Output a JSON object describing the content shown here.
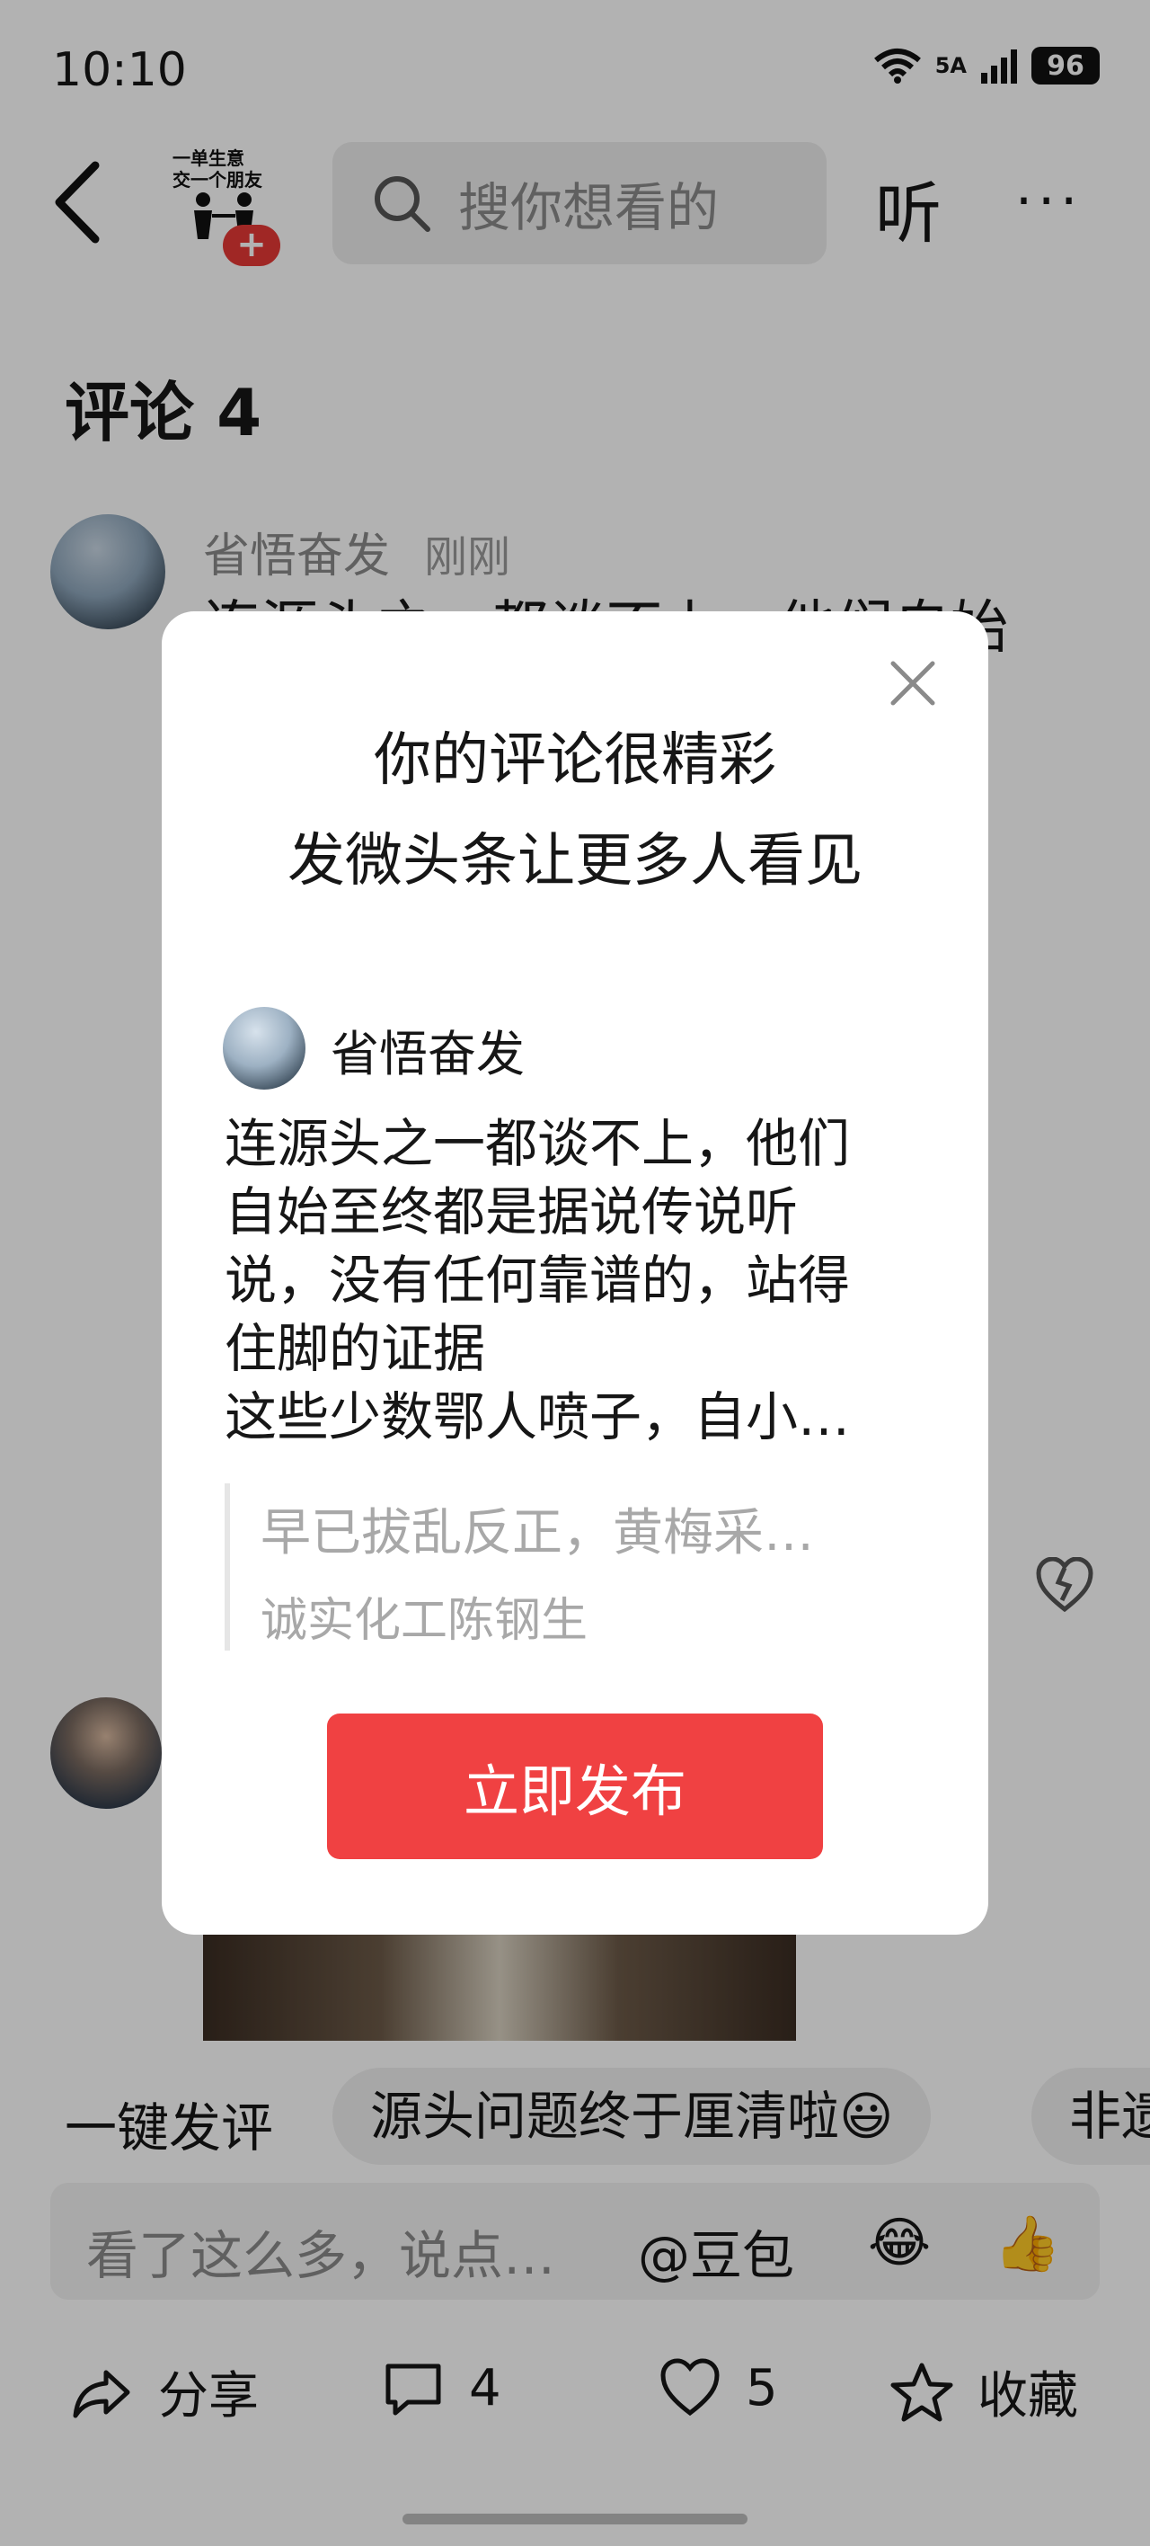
{
  "status_bar": {
    "time": "10:10",
    "network": "5A",
    "battery": "96"
  },
  "header": {
    "logo_text": [
      "一单生意",
      "交一个朋友"
    ],
    "logo_plus": "+",
    "search_placeholder": "搜你想看的",
    "listen_label": "听",
    "more_label": "···"
  },
  "comments": {
    "title": "评论 4",
    "items": [
      {
        "author": "省悟奋发",
        "time": "刚刚",
        "text_partial": "连源头之一都谈不上，他们自始\n                                有任\n\n                                故牛\n                                村、\n                                洋口\n                                练了\n                                街，"
      }
    ]
  },
  "chips": {
    "label": "一键发评",
    "items": [
      "源头问题终于厘清啦😃",
      "非遗"
    ]
  },
  "input": {
    "placeholder": "看了这么多，说点…",
    "mention": "@豆包",
    "emoji1": "😂",
    "emoji2": "👍"
  },
  "bottom_bar": {
    "share": "分享",
    "comments_count": "4",
    "likes_count": "5",
    "favorite": "收藏"
  },
  "modal": {
    "title_line1": "你的评论很精彩",
    "title_line2": "发微头条让更多人看见",
    "author": "省悟奋发",
    "comment_text": "连源头之一都谈不上，他们\n自始至终都是据说传说听\n说，没有任何靠谱的，站得\n住脚的证据\n这些少数鄂人喷子，自小…",
    "quote_text": "早已拔乱反正，黄梅采…",
    "quote_author": "诚实化工陈钢生",
    "publish_label": "立即发布"
  },
  "colors": {
    "accent": "#f04142",
    "overlay": "rgba(0,0,0,0.30)"
  }
}
